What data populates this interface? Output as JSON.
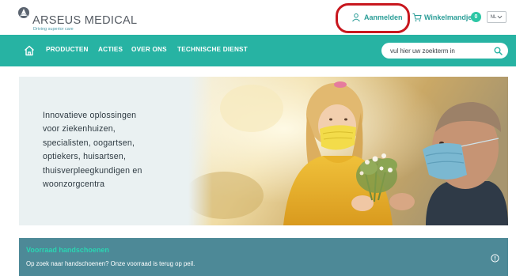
{
  "brand": {
    "name": "ARSEUS MEDICAL",
    "tagline": "Driving superior care"
  },
  "header": {
    "login_label": "Aanmelden",
    "login_icon": "user-icon",
    "cart_label": "Winkelmandje",
    "cart_icon": "cart-icon",
    "cart_count": "0",
    "language": "NL",
    "accent_color": "#2a9d97",
    "highlight_color": "#c8171e"
  },
  "nav": {
    "home_icon": "home-icon",
    "items": [
      {
        "label": "PRODUCTEN"
      },
      {
        "label": "ACTIES"
      },
      {
        "label": "OVER ONS"
      },
      {
        "label": "TECHNISCHE DIENST"
      }
    ],
    "search_placeholder": "vul hier uw zoekterm in",
    "background_color": "#27b3a3"
  },
  "hero": {
    "lines": [
      "Innovatieve oplossingen",
      "voor ziekenhuizen,",
      "specialisten, oogartsen,",
      "optiekers, huisartsen,",
      "thuisverpleegkundigen en",
      "woonzorgcentra"
    ]
  },
  "alert": {
    "title": "Voorraad handschoenen",
    "body": "Op zoek naar handschoenen? Onze voorraad is terug op peil.",
    "icon": "info-icon",
    "background_color": "#4d8997"
  }
}
